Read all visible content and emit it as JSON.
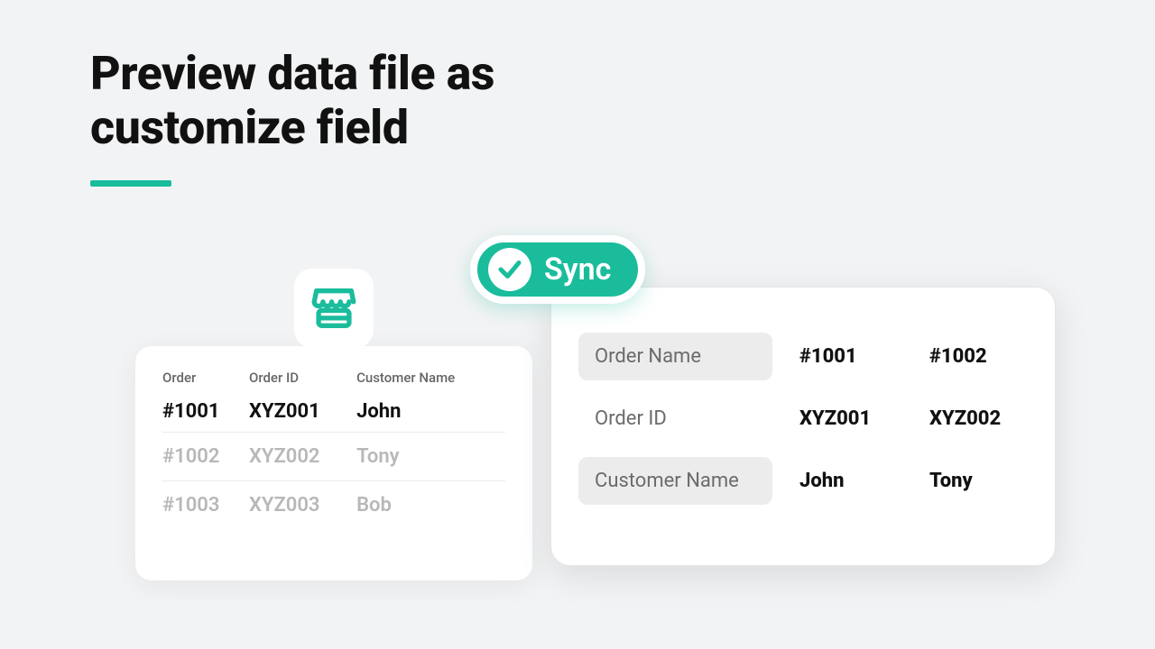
{
  "heading": {
    "line1": "Preview data file as",
    "line2": "customize field"
  },
  "sync": {
    "label": "Sync"
  },
  "source_table": {
    "columns": [
      "Order",
      "Order ID",
      "Customer Name"
    ],
    "rows": [
      {
        "order": "#1001",
        "order_id": "XYZ001",
        "customer": "John",
        "faded": false
      },
      {
        "order": "#1002",
        "order_id": "XYZ002",
        "customer": "Tony",
        "faded": true
      },
      {
        "order": "#1003",
        "order_id": "XYZ003",
        "customer": "Bob",
        "faded": true
      }
    ]
  },
  "mapped": {
    "rows": [
      {
        "label": "Order Name",
        "values": [
          "#1001",
          "#1002"
        ],
        "pill": true
      },
      {
        "label": "Order ID",
        "values": [
          "XYZ001",
          "XYZ002"
        ],
        "pill": false
      },
      {
        "label": "Customer Name",
        "values": [
          "John",
          "Tony"
        ],
        "pill": true
      }
    ]
  },
  "colors": {
    "accent": "#1abc9c"
  }
}
